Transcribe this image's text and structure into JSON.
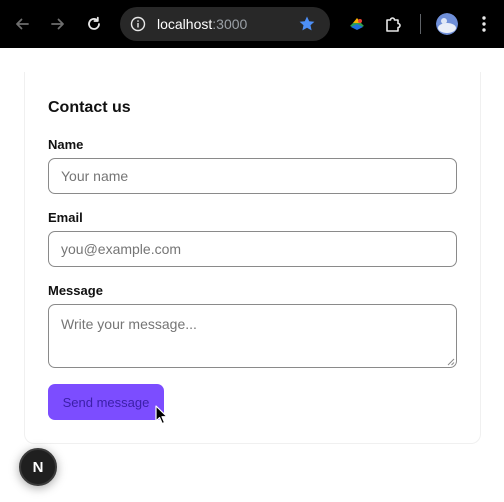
{
  "browser": {
    "url_host": "localhost",
    "url_port": ":3000",
    "icons": {
      "back": "arrow-left-icon",
      "forward": "arrow-right-icon",
      "reload": "reload-icon",
      "site_info": "info-icon",
      "bookmark": "star-icon",
      "extension": "colorful-extension-icon",
      "extensions_menu": "puzzle-icon",
      "profile": "avatar-icon",
      "menu": "kebab-menu-icon"
    },
    "colors": {
      "bookmark_star": "#4d8ff6",
      "chrome_bg": "#000000",
      "omnibox_bg": "#282828"
    }
  },
  "form": {
    "title": "Contact us",
    "fields": {
      "name": {
        "label": "Name",
        "placeholder": "Your name",
        "value": ""
      },
      "email": {
        "label": "Email",
        "placeholder": "you@example.com",
        "value": ""
      },
      "message": {
        "label": "Message",
        "placeholder": "Write your message...",
        "value": ""
      }
    },
    "submit": {
      "label": "Send message",
      "color": "#7c4dff"
    }
  },
  "dev_badge": {
    "label": "N",
    "icon": "nextjs-logo-icon"
  }
}
